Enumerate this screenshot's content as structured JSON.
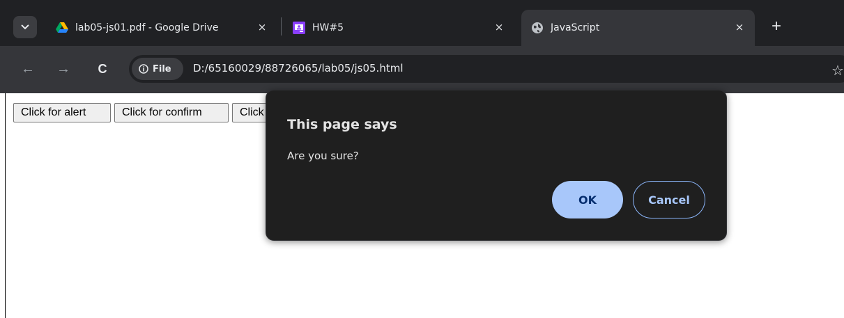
{
  "tabs": [
    {
      "title": "lab05-js01.pdf - Google Drive",
      "icon": "google-drive-icon"
    },
    {
      "title": "HW#5",
      "icon": "classroom-icon"
    },
    {
      "title": "JavaScript",
      "icon": "globe-icon",
      "active": true
    }
  ],
  "tab_close_glyph": "×",
  "new_tab_glyph": "+",
  "toolbar": {
    "back_glyph": "←",
    "forward_glyph": "→",
    "reload_glyph": "C",
    "chip_label": "File",
    "url": "D:/65160029/88726065/lab05/js05.html",
    "star_glyph": "☆"
  },
  "page": {
    "buttons": [
      "Click for alert",
      "Click for confirm",
      "Click"
    ]
  },
  "dialog": {
    "title": "This page says",
    "message": "Are you sure?",
    "ok_label": "OK",
    "cancel_label": "Cancel"
  },
  "colors": {
    "frame": "#202124",
    "toolbar": "#35363a",
    "dialog_bg": "#1f1f1f",
    "ok_bg": "#a8c7fa",
    "cancel_border": "#8ab4f8"
  }
}
